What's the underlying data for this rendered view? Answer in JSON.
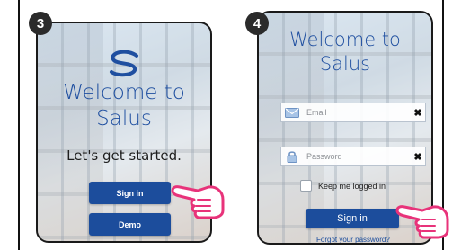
{
  "steps": [
    {
      "number": "3",
      "welcome_line1": "Welcome to",
      "welcome_line2": "Salus",
      "tagline": "Let's get started.",
      "sign_in_label": "Sign in",
      "demo_label": "Demo"
    },
    {
      "number": "4",
      "welcome_line1": "Welcome to",
      "welcome_line2": "Salus",
      "email_placeholder": "Email",
      "password_placeholder": "Password",
      "keep_logged_in_label": "Keep me logged in",
      "sign_in_label": "Sign in",
      "forgot_label": "Forgot your password?"
    }
  ],
  "colors": {
    "brand_blue": "#1c4d9c",
    "title_blue": "#1f4fa0",
    "badge_dark": "#2b2b2b",
    "hand_pink": "#e8337a"
  },
  "icons": [
    "salus-logo-icon",
    "envelope-icon",
    "lock-icon",
    "clear-icon",
    "pointing-hand-icon"
  ]
}
